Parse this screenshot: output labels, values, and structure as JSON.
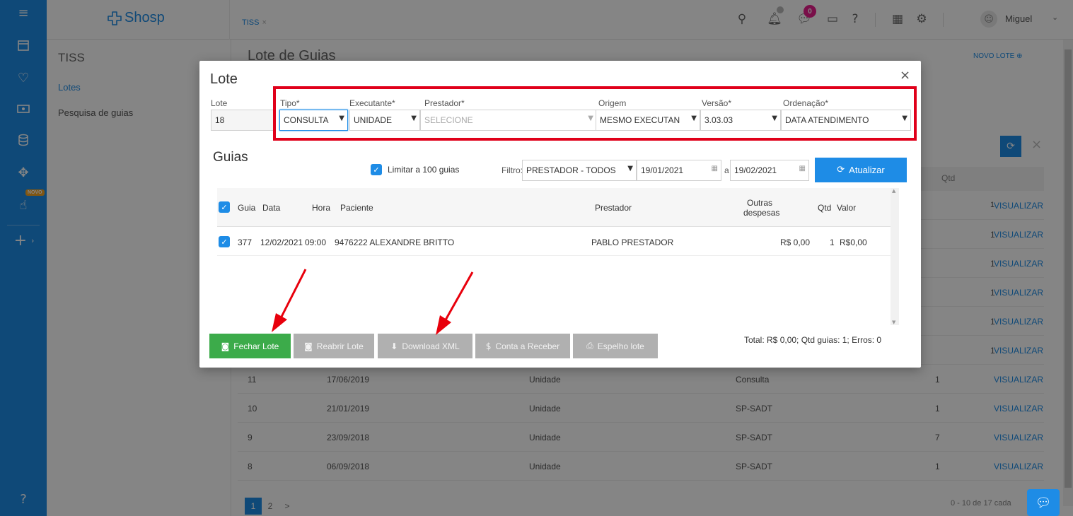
{
  "app": {
    "logo": "Shosp",
    "tab": "TISS",
    "notifications_badge": "0",
    "user": "Miguel"
  },
  "sidebar": {
    "title": "TISS",
    "links": [
      "Lotes",
      "Pesquisa de guias"
    ],
    "novo_badge": "NOVO"
  },
  "background": {
    "heading": "Lote de Guias",
    "novo_lote": "NOVO LOTE ⊕",
    "qtd_header": "Qtd",
    "rows": [
      {
        "id": "",
        "date": "",
        "exec": "",
        "type": "",
        "qtd": "1",
        "action": "VISUALIZAR"
      },
      {
        "id": "",
        "date": "",
        "exec": "",
        "type": "",
        "qtd": "1",
        "action": "VISUALIZAR"
      },
      {
        "id": "",
        "date": "",
        "exec": "",
        "type": "",
        "qtd": "1",
        "action": "VISUALIZAR"
      },
      {
        "id": "",
        "date": "",
        "exec": "",
        "type": "",
        "qtd": "1",
        "action": "VISUALIZAR"
      },
      {
        "id": "",
        "date": "",
        "exec": "",
        "type": "",
        "qtd": "1",
        "action": "VISUALIZAR"
      },
      {
        "id": "",
        "date": "",
        "exec": "",
        "type": "",
        "qtd": "1",
        "action": "VISUALIZAR"
      },
      {
        "id": "11",
        "date": "17/06/2019",
        "exec": "Unidade",
        "type": "Consulta",
        "qtd": "1",
        "action": "VISUALIZAR"
      },
      {
        "id": "10",
        "date": "21/01/2019",
        "exec": "Unidade",
        "type": "SP-SADT",
        "qtd": "1",
        "action": "VISUALIZAR"
      },
      {
        "id": "9",
        "date": "23/09/2018",
        "exec": "Unidade",
        "type": "SP-SADT",
        "qtd": "7",
        "action": "VISUALIZAR"
      },
      {
        "id": "8",
        "date": "06/09/2018",
        "exec": "Unidade",
        "type": "SP-SADT",
        "qtd": "1",
        "action": "VISUALIZAR"
      }
    ],
    "pages": [
      "1",
      "2",
      ">"
    ],
    "count": "0 - 10 de 17 cada"
  },
  "modal": {
    "title": "Lote",
    "close": "×",
    "fields": {
      "lote": {
        "label": "Lote",
        "value": "18"
      },
      "tipo": {
        "label": "Tipo*",
        "value": "CONSULTA"
      },
      "executante": {
        "label": "Executante*",
        "value": "UNIDADE"
      },
      "prestador": {
        "label": "Prestador*",
        "value": "SELECIONE"
      },
      "origem": {
        "label": "Origem",
        "value": "MESMO EXECUTAN"
      },
      "versao": {
        "label": "Versão*",
        "value": "3.03.03"
      },
      "ordenacao": {
        "label": "Ordenação*",
        "value": "DATA ATENDIMENTO"
      }
    },
    "guias_title": "Guias",
    "limitar": "Limitar a 100 guias",
    "filtro_label": "Filtro:",
    "filtro_value": "PRESTADOR - TODOS",
    "date_from": "19/01/2021",
    "date_sep": "a",
    "date_to": "19/02/2021",
    "atualizar": "Atualizar",
    "table": {
      "headers": [
        "Guia",
        "Data",
        "Hora",
        "Paciente",
        "Prestador",
        "Outras",
        "despesas",
        "Qtd",
        "Valor"
      ],
      "rows": [
        {
          "guia": "377",
          "data": "12/02/2021",
          "hora": "09:00",
          "paciente": "9476222 ALEXANDRE BRITTO",
          "prestador": "PABLO PRESTADOR",
          "outras": "R$ 0,00",
          "qtd": "1",
          "valor": "R$0,00"
        }
      ]
    },
    "buttons": {
      "fechar": "Fechar Lote",
      "reabrir": "Reabrir Lote",
      "download": "Download XML",
      "conta": "Conta a Receber",
      "espelho": "Espelho lote"
    },
    "totals": "Total: R$ 0,00;  Qtd guias: 1;  Erros: 0"
  },
  "colors": {
    "primary": "#1e8ce6",
    "success": "#3cab4a",
    "highlight": "#e0001a"
  }
}
